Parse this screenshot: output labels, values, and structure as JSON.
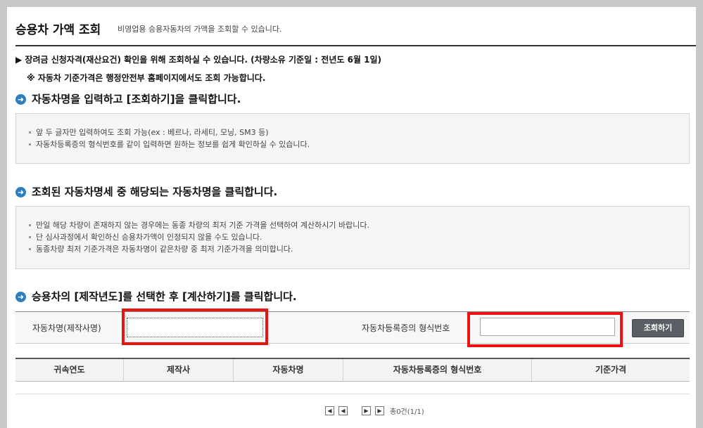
{
  "header": {
    "title": "승용차 가액 조회",
    "subtitle": "비영업용 승용자동차의 가액을 조회할 수 있습니다."
  },
  "notices": {
    "line1": "▶ 장려금 신청자격(재산요건) 확인을 위해 조회하실 수 있습니다. (차량소유 기준일 : 전년도 6월 1일)",
    "line2": "※ 자동차 기준가격은 행정안전부 홈페이지에서도 조회 가능합니다."
  },
  "steps": {
    "step1": "자동차명을 입력하고 [조회하기]을 클릭합니다.",
    "step2": "조회된 자동차명세 중 해당되는 자동차명을 클릭합니다.",
    "step3": "승용차의 [제작년도]를 선택한 후 [계산하기]를 클릭합니다."
  },
  "info1": [
    "앞 두 글자만 입력하여도 조회 가능(ex : 베르나, 라세티, 모닝, SM3 등)",
    "자동차등록증의 형식번호를 같이 입력하면 원하는 정보를 쉽게 확인하실 수 있습니다."
  ],
  "info2": [
    "만일 해당 차량이 존재하지 않는 경우에는 동종 차량의 최저 기준 가격을 선택하여 계산하시기 바랍니다.",
    "단 심사과정에서 확인하신 승용차가액이 인정되지 않을 수도 있습니다.",
    "동종차량 최저 기준가격은 자동차명이 같은차량 중  최저 기준가격을 의미합니다."
  ],
  "search": {
    "car_name_label": "자동차명(제작사명)",
    "car_name_value": "",
    "form_number_label": "자동차등록증의 형식번호",
    "form_number_value": "",
    "button_label": "조회하기"
  },
  "table": {
    "headers": [
      "귀속연도",
      "제작사",
      "자동차명",
      "자동차등록증의 형식번호",
      "기준가격"
    ]
  },
  "pager": {
    "first": "◀",
    "prev": "◀",
    "next": "▶",
    "last": "▶",
    "status": "총0건(1/1)"
  },
  "colors": {
    "highlight": "#ee1111",
    "step_icon": "#2a7fc0",
    "button": "#5a5f66"
  }
}
